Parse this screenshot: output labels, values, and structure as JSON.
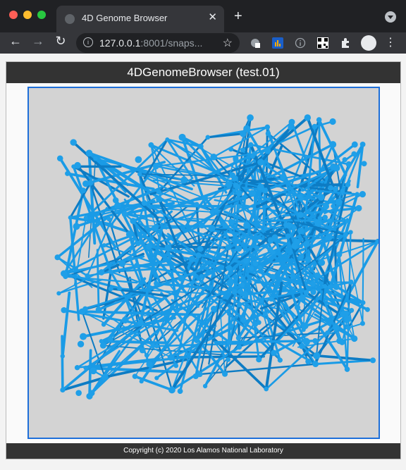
{
  "browser": {
    "tab_title": "4D Genome Browser",
    "new_tab_icon": "+",
    "close_icon": "✕",
    "url_host": "127.0.0.1",
    "url_rest": ":8001/snaps..."
  },
  "app": {
    "title": "4DGenomeBrowser (test.01)",
    "footer": "Copyright (c) 2020 Los Alamos National Laboratory"
  },
  "viewer": {
    "background_color": "#d3d3d3",
    "line_color": "#1a9be6",
    "node_color": "#1f9fe8",
    "border_color": "#1e6fd9"
  }
}
